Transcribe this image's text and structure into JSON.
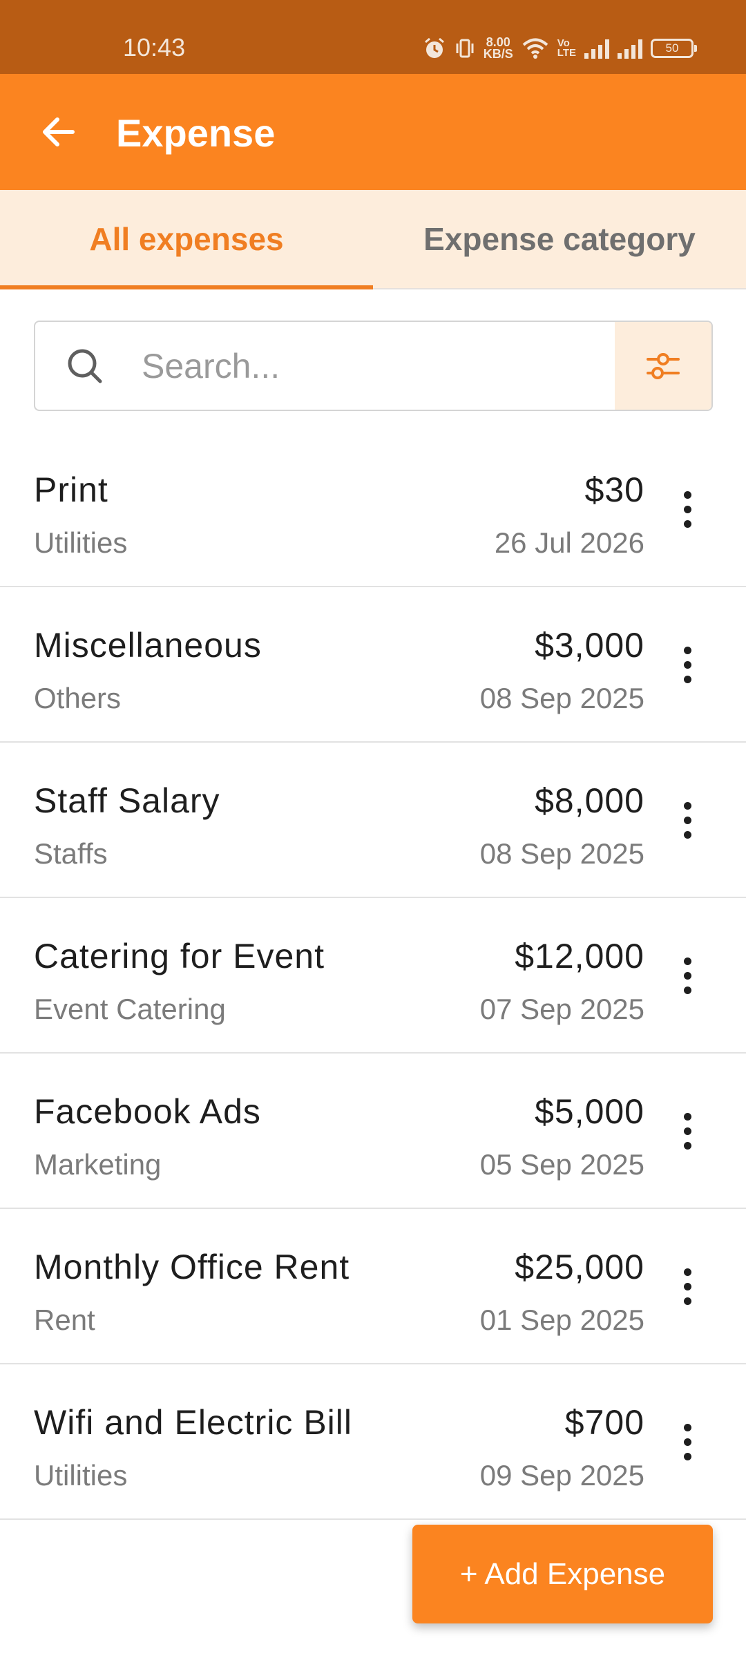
{
  "status_bar": {
    "time": "10:43",
    "speed_top": "8.00",
    "speed_bottom": "KB/S",
    "volte_top": "Vo",
    "volte_bottom": "LTE",
    "battery": "50",
    "icons": [
      "alarm-icon",
      "vibrate-icon",
      "wifi-icon",
      "signal-icon",
      "signal-icon",
      "battery-icon"
    ]
  },
  "app_bar": {
    "title": "Expense",
    "back_icon": "arrow-left-icon"
  },
  "tabs": [
    {
      "label": "All expenses",
      "active": true
    },
    {
      "label": "Expense category",
      "active": false
    }
  ],
  "search": {
    "placeholder": "Search...",
    "value": ""
  },
  "expenses": [
    {
      "title": "Print",
      "category": "Utilities",
      "amount": "$30",
      "date": "26 Jul 2026"
    },
    {
      "title": "Miscellaneous",
      "category": "Others",
      "amount": "$3,000",
      "date": "08 Sep 2025"
    },
    {
      "title": "Staff Salary",
      "category": "Staffs",
      "amount": "$8,000",
      "date": "08 Sep 2025"
    },
    {
      "title": "Catering for Event",
      "category": "Event Catering",
      "amount": "$12,000",
      "date": "07 Sep 2025"
    },
    {
      "title": "Facebook Ads",
      "category": "Marketing",
      "amount": "$5,000",
      "date": "05 Sep 2025"
    },
    {
      "title": "Monthly Office Rent",
      "category": "Rent",
      "amount": "$25,000",
      "date": "01 Sep 2025"
    },
    {
      "title": "Wifi and Electric Bill",
      "category": "Utilities",
      "amount": "$700",
      "date": "09 Sep 2025"
    }
  ],
  "add_button": {
    "label": "+ Add Expense"
  },
  "colors": {
    "primary": "#fb8420",
    "status_bar": "#b85c14",
    "tab_background": "#fdeddc",
    "active_tab": "#f07e22"
  }
}
